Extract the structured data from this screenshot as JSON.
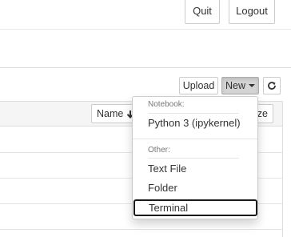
{
  "header": {
    "quit_label": "Quit",
    "logout_label": "Logout"
  },
  "toolbar": {
    "upload_label": "Upload",
    "new_label": "New",
    "refresh_icon": "refresh-icon"
  },
  "list": {
    "sort_label": "Name",
    "sort_arrow": "🡓",
    "size_label": "ze"
  },
  "new_menu": {
    "notebook_header": "Notebook:",
    "notebook_items": [
      "Python 3 (ipykernel)"
    ],
    "other_header": "Other:",
    "other_items": [
      "Text File",
      "Folder",
      "Terminal"
    ]
  }
}
